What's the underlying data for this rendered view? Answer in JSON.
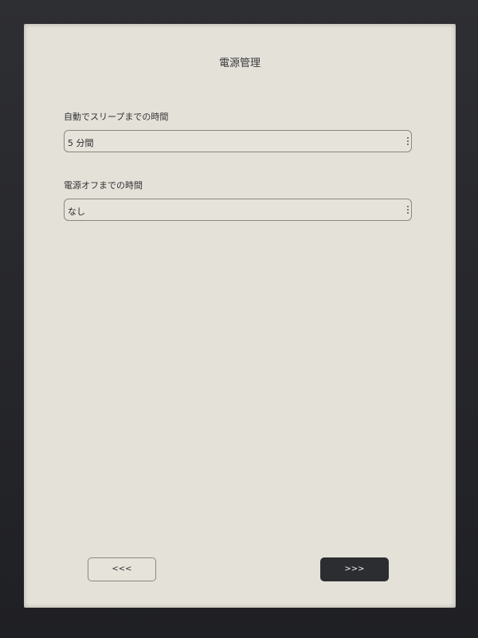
{
  "page": {
    "title": "電源管理"
  },
  "settings": [
    {
      "label": "自動でスリープまでの時間",
      "value": "5 分間"
    },
    {
      "label": "電源オフまでの時間",
      "value": "なし"
    }
  ],
  "navigation": {
    "back_label": "<<<",
    "next_label": ">>>"
  },
  "colors": {
    "screen_background": "#e4e1d9",
    "bezel": "#2a2a2c",
    "primary_button": "#2c2d30"
  },
  "icons": {
    "select_menu": "kebab-icon"
  }
}
